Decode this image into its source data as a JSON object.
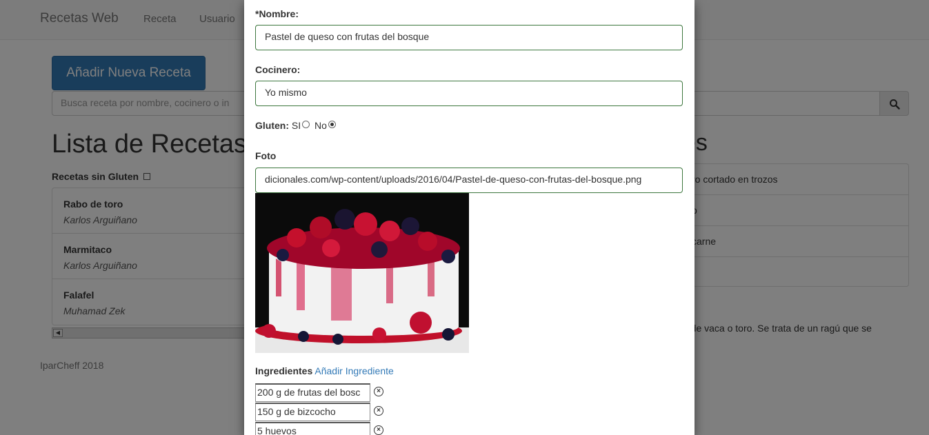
{
  "navbar": {
    "brand": "Recetas Web",
    "links": [
      "Receta",
      "Usuario"
    ]
  },
  "page": {
    "add_button": "Añadir Nueva Receta",
    "search_placeholder": "Busca receta por nombre, cocinero o in",
    "list_title": "Lista de Recetas",
    "right_title": "es",
    "gluten_filter_label": "Recetas sin Gluten",
    "recipes": [
      {
        "name": "Rabo de toro",
        "cook": "Karlos Arguiñano"
      },
      {
        "name": "Marmitaco",
        "cook": "Karlos Arguiñano"
      },
      {
        "name": "Falafel",
        "cook": "Muhamad Zek"
      }
    ],
    "right_items": [
      "ro cortado en trozos",
      "o",
      "carne",
      ""
    ],
    "right_desc": "o de vaca o toro. Se trata de un ragú que se",
    "footer": "IparCheff 2018"
  },
  "modal": {
    "name_label": "*Nombre:",
    "name_value": "Pastel de queso con frutas del bosque",
    "cook_label": "Cocinero:",
    "cook_value": "Yo mismo",
    "gluten_label": "Gluten:",
    "gluten_yes": "SI",
    "gluten_no": "No",
    "gluten_selected": "No",
    "photo_label": "Foto",
    "photo_url": "dicionales.com/wp-content/uploads/2016/04/Pastel-de-queso-con-frutas-del-bosque.png",
    "ingredients_label": "Ingredientes",
    "add_ingredient_link": "Añadir Ingrediente",
    "ingredients": [
      "200 g de frutas del bosc",
      "150 g de bizcocho",
      "5 huevos"
    ]
  },
  "colors": {
    "primary": "#337ab7",
    "valid_border": "#3c763d",
    "overlay": "rgba(0,0,0,0.5)"
  }
}
